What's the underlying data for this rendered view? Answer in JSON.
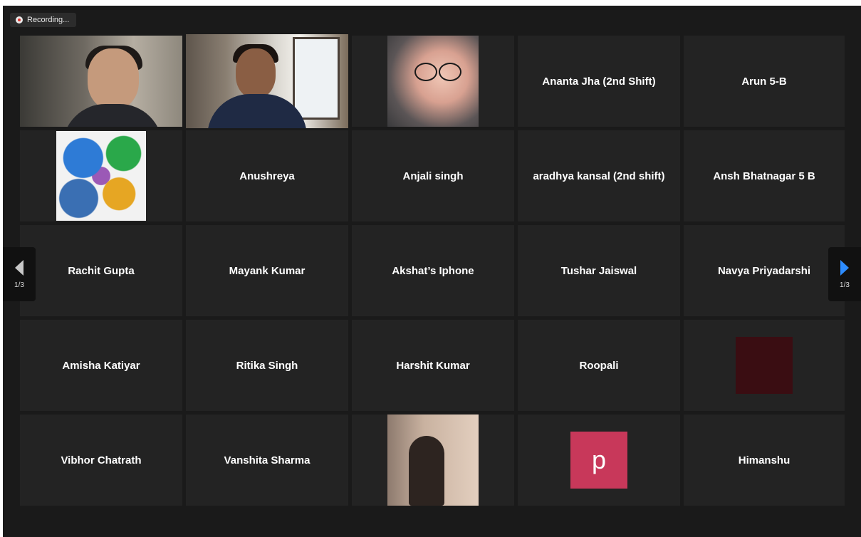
{
  "recording": {
    "label": "Recording..."
  },
  "pagination": {
    "left_label": "1/3",
    "right_label": "1/3"
  },
  "participants": [
    {
      "name": "Ananta Jha (2nd Shift)"
    },
    {
      "name": "Arun 5-B"
    },
    {
      "name": "Anushreya"
    },
    {
      "name": "Anjali singh"
    },
    {
      "name": "aradhya kansal (2nd shift)"
    },
    {
      "name": "Ansh Bhatnagar 5 B"
    },
    {
      "name": "Rachit Gupta"
    },
    {
      "name": "Mayank Kumar"
    },
    {
      "name": "Akshat’s Iphone"
    },
    {
      "name": "Tushar Jaiswal"
    },
    {
      "name": "Navya Priyadarshi"
    },
    {
      "name": "Amisha Katiyar"
    },
    {
      "name": "Ritika Singh"
    },
    {
      "name": "Harshit Kumar"
    },
    {
      "name": "Roopali"
    },
    {
      "name": "Vibhor Chatrath"
    },
    {
      "name": "Vanshita Sharma"
    },
    {
      "name": "Himanshu"
    }
  ],
  "avatar_initial": "p",
  "colors": {
    "active_speaker_border": "#d4e157",
    "next_arrow": "#2d8cff",
    "avatar_bg": "#c8385a"
  }
}
